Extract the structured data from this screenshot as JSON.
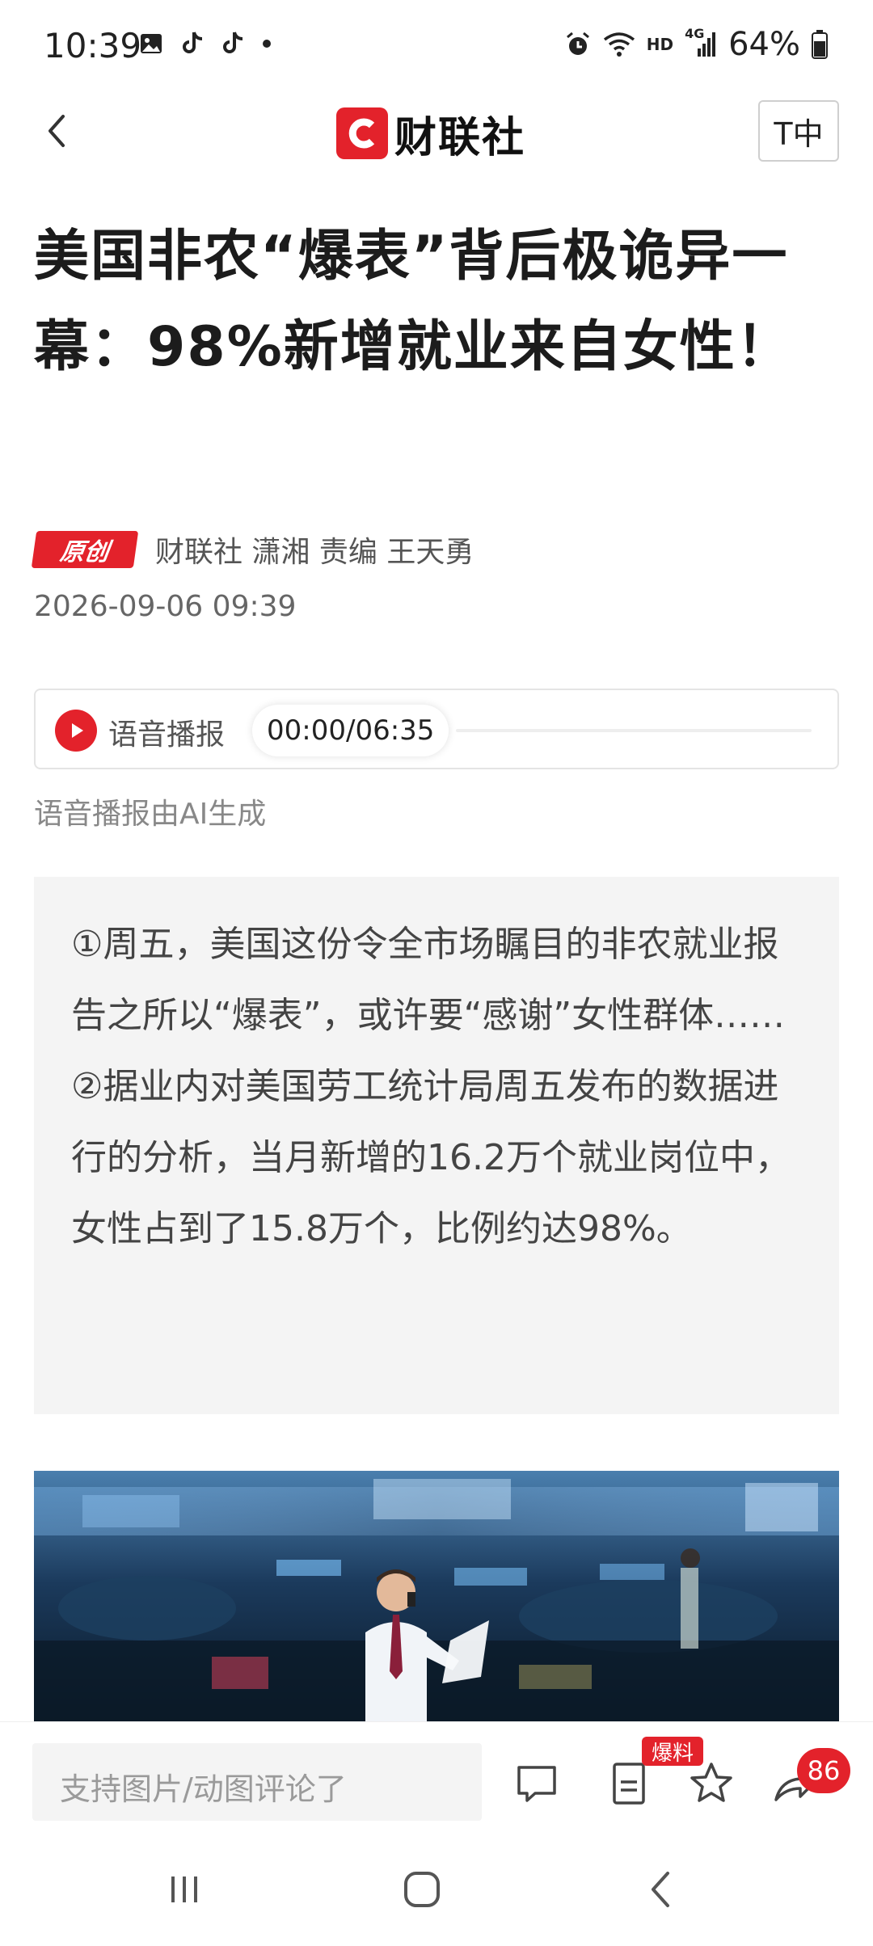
{
  "status_bar": {
    "time": "10:39",
    "hd_label": "HD",
    "network_label": "4G",
    "battery": "64%"
  },
  "nav": {
    "logo_text": "财联社",
    "font_button": "T中"
  },
  "article": {
    "title": "美国非农“爆表”背后极诡异一幕：98%新增就业来自女性！",
    "badge": "原创",
    "author": "财联社 潇湘  责编 王天勇",
    "date": "2026-09-06 09:39"
  },
  "audio": {
    "label": "语音播报",
    "current_time": "00:00",
    "separator": "/",
    "duration": "06:35",
    "note": "语音播报由AI生成"
  },
  "summary": {
    "para1": "①周五，美国这份令全市场瞩目的非农就业报告之所以“爆表”，或许要“感谢”女性群体……",
    "para2": "②据业内对美国劳工统计局周五发布的数据进行的分析，当月新增的16.2万个就业岗位中，女性占到了15.8万个，比例约达98%。"
  },
  "bottom_bar": {
    "comment_placeholder": "支持图片/动图评论了",
    "tip_badge": "爆料",
    "share_count": "86"
  },
  "colors": {
    "brand_red": "#e3222b",
    "summary_bg": "#f4f4f4"
  },
  "icons": {
    "back": "chevron-left-icon",
    "play": "play-icon",
    "comment": "comment-icon",
    "tip": "document-icon",
    "favorite": "star-icon",
    "share": "share-icon",
    "recents": "recents-icon",
    "home": "home-icon",
    "system_back": "system-back-icon"
  }
}
